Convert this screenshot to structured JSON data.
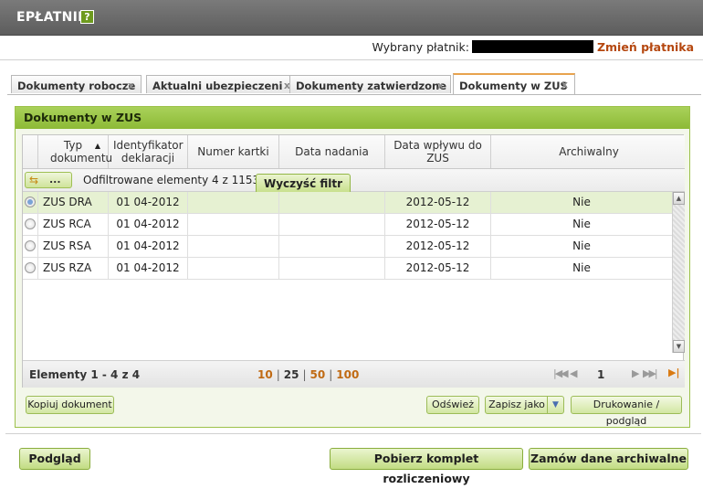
{
  "app": {
    "title": "EPŁATNIK",
    "help_label": "?"
  },
  "payer": {
    "label": "Wybrany płatnik:",
    "change_link": "Zmień płatnika"
  },
  "tabs": [
    {
      "label": "Dokumenty robocze",
      "close": "x"
    },
    {
      "label": "Aktualni ubezpieczeni",
      "close": "x"
    },
    {
      "label": "Dokumenty zatwierdzone",
      "close": "x"
    },
    {
      "label": "Dokumenty w ZUS",
      "close": "x",
      "active": true
    }
  ],
  "panel": {
    "title": "Dokumenty w ZUS",
    "columns": [
      {
        "label": "Typ dokumentu",
        "sorted": "asc"
      },
      {
        "label": "Identyfikator deklaracji"
      },
      {
        "label": "Numer kartki"
      },
      {
        "label": "Data nadania"
      },
      {
        "label": "Data wpływu do ZUS"
      },
      {
        "label": "Archiwalny"
      }
    ],
    "filter": {
      "button_label": "...",
      "status": "Odfiltrowane elementy 4 z 1153.",
      "clear_label": "Wyczyść filtr"
    },
    "rows": [
      {
        "type": "ZUS DRA",
        "declaration": "01 04-2012",
        "card": "",
        "sent": "",
        "received": "2012-05-12",
        "archived": "Nie",
        "selected": true
      },
      {
        "type": "ZUS RCA",
        "declaration": "01 04-2012",
        "card": "",
        "sent": "",
        "received": "2012-05-12",
        "archived": "Nie",
        "selected": false
      },
      {
        "type": "ZUS RSA",
        "declaration": "01 04-2012",
        "card": "",
        "sent": "",
        "received": "2012-05-12",
        "archived": "Nie",
        "selected": false
      },
      {
        "type": "ZUS RZA",
        "declaration": "01 04-2012",
        "card": "",
        "sent": "",
        "received": "2012-05-12",
        "archived": "Nie",
        "selected": false
      }
    ],
    "pager": {
      "summary": "Elementy 1 - 4 z 4",
      "page_sizes": [
        "10",
        "25",
        "50",
        "100"
      ],
      "current_size": "25",
      "separator": "|",
      "current_page": "1"
    },
    "actions": {
      "copy": "Kopiuj dokument",
      "refresh": "Odśwież",
      "save_as": "Zapisz jako",
      "print": "Drukowanie / podgląd"
    }
  },
  "bottom": {
    "preview": "Podgląd",
    "download_set": "Pobierz komplet rozliczeniowy",
    "order_archive": "Zamów dane archiwalne"
  }
}
